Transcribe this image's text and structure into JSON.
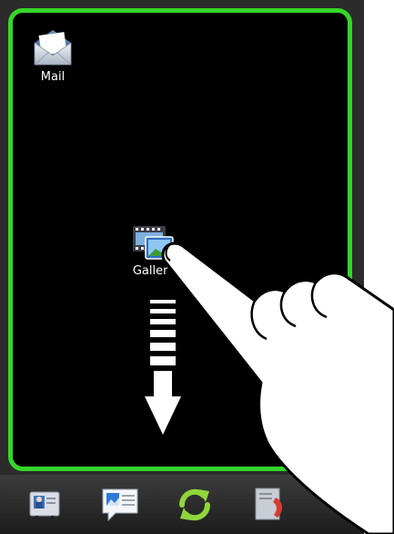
{
  "home": {
    "apps": [
      {
        "label": "Mail",
        "icon": "mail-envelope-icon"
      },
      {
        "label": "Gallery",
        "icon": "gallery-filmstrip-photo-icon"
      }
    ]
  },
  "gesture": {
    "icon": "pointing-hand-icon",
    "arrow": "drag-down-arrow-icon"
  },
  "dock": {
    "items": [
      {
        "name": "contacts",
        "icon": "contacts-card-icon"
      },
      {
        "name": "messages",
        "icon": "message-bubble-icon"
      },
      {
        "name": "sync",
        "icon": "sync-arrows-icon"
      },
      {
        "name": "call-log",
        "icon": "phone-log-icon"
      }
    ]
  },
  "colors": {
    "panel_border": "#34d62a",
    "panel_bg": "#000000",
    "dock_bg": "#2b2b2b",
    "sync_green": "#8fd63c"
  }
}
